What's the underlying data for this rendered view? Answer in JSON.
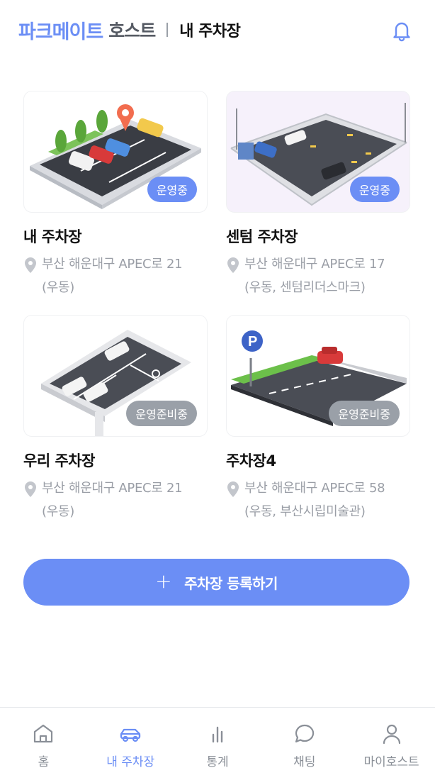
{
  "header": {
    "brand": "파크메이트",
    "brand_sub": "호스트",
    "title": "내 주차장",
    "bell_icon": "bell-icon"
  },
  "parking_lots": [
    {
      "name": "내 주차장",
      "status": "운영중",
      "address_line1": "부산 해운대구 APEC로 21",
      "address_line2": "(우동)"
    },
    {
      "name": "센텀 주차장",
      "status": "운영중",
      "address_line1": "부산 해운대구 APEC로 17",
      "address_line2": "(우동, 센텀리더스마크)"
    },
    {
      "name": "우리 주차장",
      "status": "운영준비중",
      "address_line1": "부산 해운대구 APEC로 21",
      "address_line2": "(우동)"
    },
    {
      "name": "주차장4",
      "status": "운영준비중",
      "address_line1": "부산 해운대구 APEC로 58",
      "address_line2": "(우동, 부산시립미술관)"
    }
  ],
  "register_button": {
    "label": "주차장 등록하기",
    "icon": "plus-icon"
  },
  "bottom_nav": {
    "active": "my-parking",
    "items": [
      {
        "label": "홈",
        "icon": "home-icon"
      },
      {
        "label": "내 주차장",
        "icon": "car-icon"
      },
      {
        "label": "통계",
        "icon": "bar-chart-icon"
      },
      {
        "label": "채팅",
        "icon": "chat-bubble-icon"
      },
      {
        "label": "마이호스트",
        "icon": "user-icon"
      }
    ]
  },
  "colors": {
    "accent": "#6b8ef5",
    "status_preparing": "#9aa0a8",
    "text_secondary": "#9a9ea6"
  }
}
